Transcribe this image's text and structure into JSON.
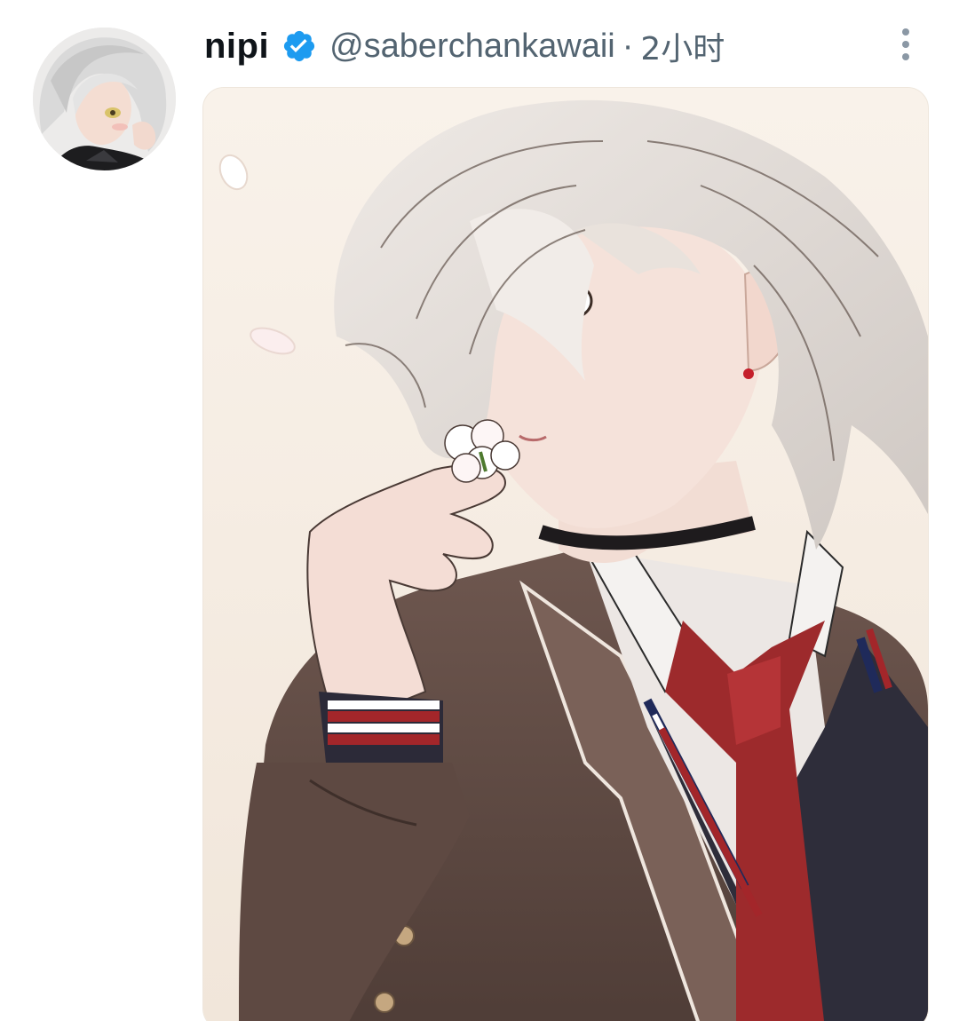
{
  "tweet": {
    "display_name": "nipi",
    "verified": true,
    "handle": "@saberchankawaii",
    "separator": "·",
    "time": "2小时"
  },
  "icons": {
    "verified": "verified-badge-icon",
    "more": "more-vertical-icon"
  },
  "colors": {
    "verified_blue": "#1d9bf0",
    "muted_text": "#536471",
    "name_text": "#0f1419"
  }
}
